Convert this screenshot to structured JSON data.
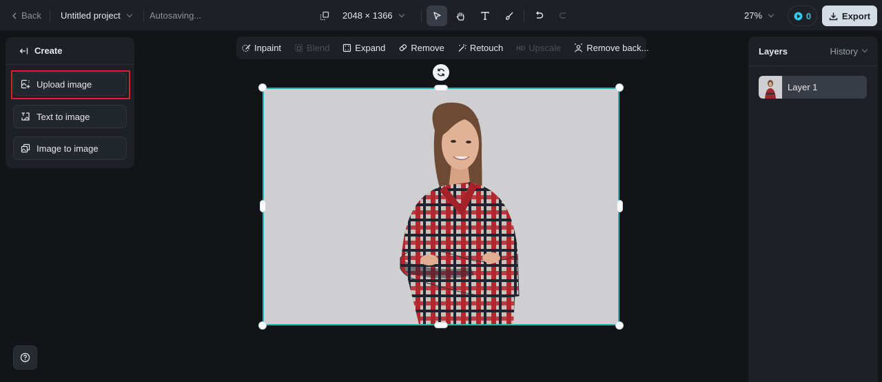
{
  "topbar": {
    "back_label": "Back",
    "project_title": "Untitled project",
    "status": "Autosaving...",
    "canvas_size": "2048 × 1366",
    "tools": [
      {
        "name": "select",
        "icon": "cursor-icon",
        "active": true
      },
      {
        "name": "hand",
        "icon": "hand-icon",
        "active": false
      },
      {
        "name": "text",
        "icon": "text-icon",
        "active": false
      },
      {
        "name": "brush",
        "icon": "brush-icon",
        "active": false
      }
    ],
    "zoom_level": "27%",
    "credits": "0",
    "export_label": "Export",
    "accent_color": "#34c6e6"
  },
  "actionbar": {
    "items": [
      {
        "label": "Inpaint",
        "icon": "inpaint-icon",
        "enabled": true
      },
      {
        "label": "Blend",
        "icon": "blend-icon",
        "enabled": false
      },
      {
        "label": "Expand",
        "icon": "expand-icon",
        "enabled": true
      },
      {
        "label": "Remove",
        "icon": "eraser-icon",
        "enabled": true
      },
      {
        "label": "Retouch",
        "icon": "magic-wand-icon",
        "enabled": true
      },
      {
        "label": "Upscale",
        "icon": "hd-icon",
        "enabled": false,
        "badge": "HD"
      },
      {
        "label": "Remove back...",
        "icon": "remove-background-icon",
        "enabled": true
      }
    ]
  },
  "left_panel": {
    "title": "Create",
    "buttons": [
      {
        "label": "Upload image",
        "icon": "upload-image-icon",
        "highlighted": true
      },
      {
        "label": "Text to image",
        "icon": "text-to-image-icon",
        "highlighted": false
      },
      {
        "label": "Image to image",
        "icon": "image-to-image-icon",
        "highlighted": false
      }
    ],
    "highlight_color": "#e01f26"
  },
  "right_panel": {
    "title": "Layers",
    "history_label": "History",
    "layers": [
      {
        "label": "Layer 1",
        "selected": true
      }
    ]
  },
  "canvas": {
    "selection_color": "#1fb5b8",
    "background_color": "#cfcfd1",
    "content": "Photo of a smiling woman in a red plaid shirt with arms crossed"
  }
}
